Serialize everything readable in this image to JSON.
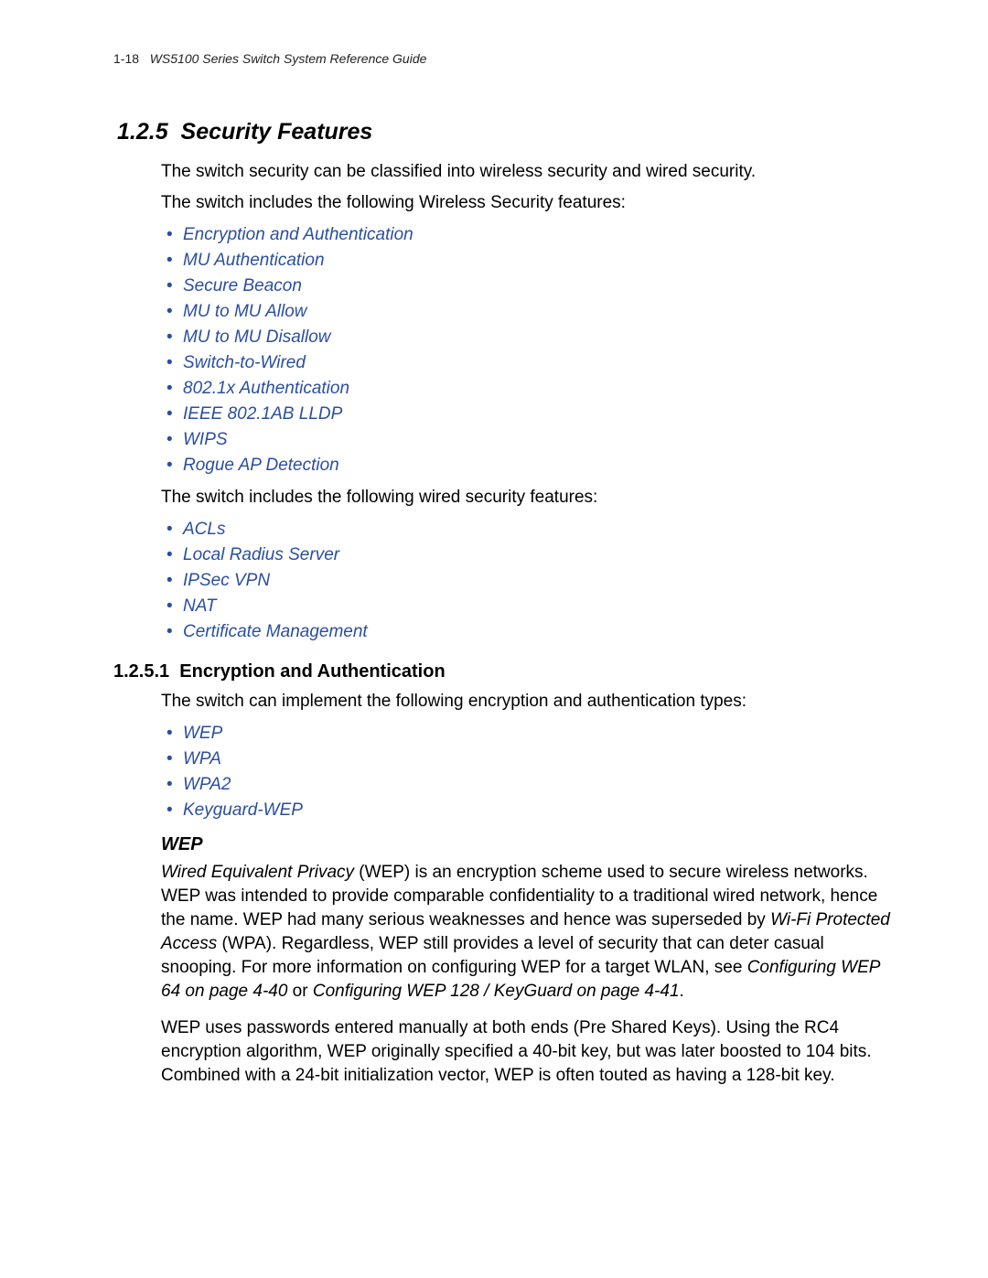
{
  "header": {
    "page_number": "1-18",
    "guide_title": "WS5100 Series Switch System Reference Guide"
  },
  "section": {
    "number": "1.2.5",
    "title": "Security Features",
    "intro_1": "The switch security can be classified into wireless security and wired security.",
    "intro_2": "The switch includes the following Wireless Security features:",
    "wireless_links": [
      "Encryption and Authentication",
      "MU Authentication",
      "Secure Beacon",
      "MU to MU Allow",
      "MU to MU Disallow",
      "Switch-to-Wired",
      "802.1x Authentication",
      "IEEE 802.1AB LLDP",
      "WIPS",
      "Rogue AP Detection"
    ],
    "wired_intro": "The switch includes the following wired security features:",
    "wired_links": [
      "ACLs",
      "Local Radius Server",
      "IPSec VPN",
      "NAT",
      "Certificate Management"
    ]
  },
  "subsection": {
    "number": "1.2.5.1",
    "title": "Encryption and Authentication",
    "intro": "The switch can implement the following encryption and authentication types:",
    "links": [
      "WEP",
      "WPA",
      "WPA2",
      "Keyguard-WEP"
    ]
  },
  "wep": {
    "heading": "WEP",
    "p1_lead": "Wired Equivalent Privacy",
    "p1_a": " (WEP) is an encryption scheme used to secure wireless networks. WEP was intended to provide comparable confidentiality to a traditional wired network, hence the name. WEP had many serious weaknesses and hence was superseded by ",
    "p1_wpa": "Wi-Fi Protected Access",
    "p1_b": " (WPA). Regardless, WEP still provides a level of security that can deter casual snooping. For more information on configuring WEP for a target WLAN, see ",
    "p1_ref1": "Configuring WEP 64 on page 4-40",
    "p1_or": " or ",
    "p1_ref2": "Configuring WEP 128 / KeyGuard on page 4-41",
    "p1_end": ".",
    "p2": "WEP uses passwords entered manually at both ends (Pre Shared Keys). Using the RC4 encryption algorithm, WEP originally specified a 40-bit key, but was later boosted to 104 bits. Combined with a 24-bit initialization vector, WEP is often touted as having a 128-bit key."
  }
}
